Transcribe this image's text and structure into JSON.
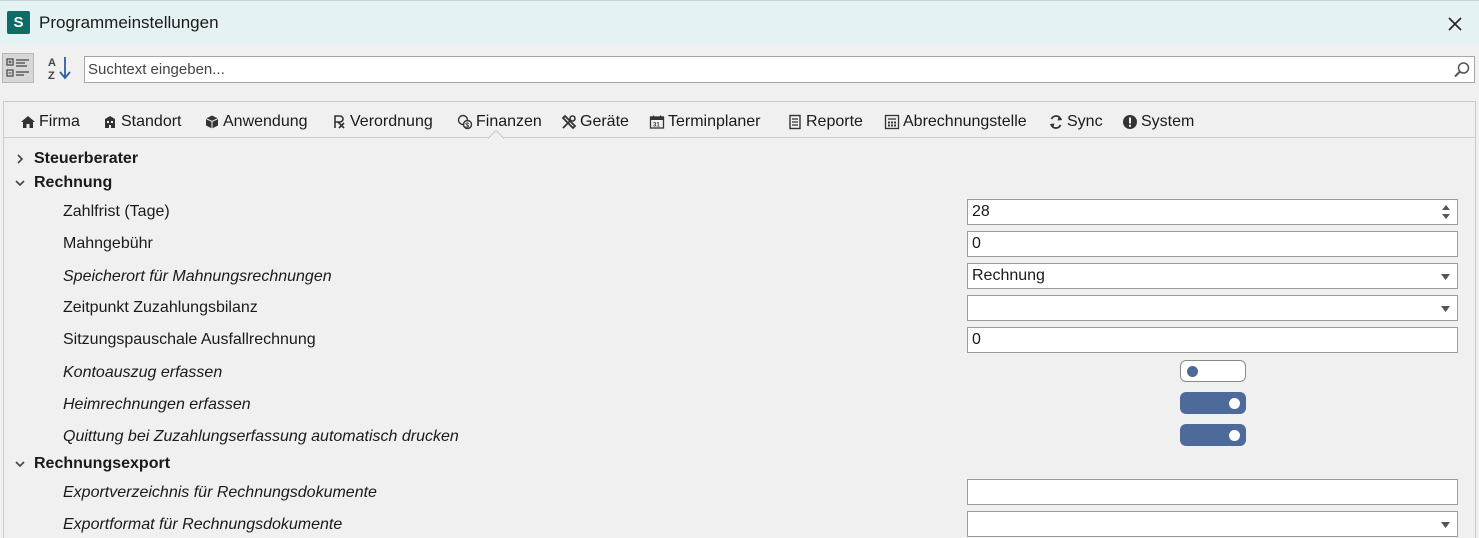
{
  "window": {
    "app_icon_letter": "S",
    "title": "Programmeinstellungen",
    "close_glyph": "✕"
  },
  "toolbar": {
    "view_categorized_icon": "categorized-view-icon",
    "sort_alpha_icon": "sort-az-icon",
    "search_placeholder": "Suchtext eingeben...",
    "search_value": ""
  },
  "tabs": [
    {
      "label": "Firma",
      "icon": "home-icon"
    },
    {
      "label": "Standort",
      "icon": "building-icon"
    },
    {
      "label": "Anwendung",
      "icon": "cube-icon"
    },
    {
      "label": "Verordnung",
      "icon": "prescription-icon"
    },
    {
      "label": "Finanzen",
      "icon": "coins-icon",
      "active": true
    },
    {
      "label": "Geräte",
      "icon": "tools-icon"
    },
    {
      "label": "Terminplaner",
      "icon": "calendar-icon"
    },
    {
      "label": "Reporte",
      "icon": "report-icon"
    },
    {
      "label": "Abrechnungstelle",
      "icon": "calculator-icon"
    },
    {
      "label": "Sync",
      "icon": "sync-icon"
    },
    {
      "label": "System",
      "icon": "alert-icon"
    }
  ],
  "groups": {
    "steuerberater": {
      "label": "Steuerberater",
      "expanded": false
    },
    "rechnung": {
      "label": "Rechnung",
      "expanded": true
    },
    "rechnungsexport": {
      "label": "Rechnungsexport",
      "expanded": true
    }
  },
  "rechnung": {
    "zahlfrist": {
      "label": "Zahlfrist (Tage)",
      "value": "28"
    },
    "mahngebuehr": {
      "label": "Mahngebühr",
      "value": "0"
    },
    "speicherort": {
      "label": "Speicherort für Mahnungsrechnungen",
      "value": "Rechnung"
    },
    "zeitpunkt": {
      "label": "Zeitpunkt Zuzahlungsbilanz",
      "value": ""
    },
    "sitzungspauschale": {
      "label": "Sitzungspauschale Ausfallrechnung",
      "value": "0"
    },
    "kontoauszug": {
      "label": "Kontoauszug erfassen",
      "on": false
    },
    "heimrechnungen": {
      "label": "Heimrechnungen erfassen",
      "on": true
    },
    "quittung": {
      "label": "Quittung bei Zuzahlungserfassung automatisch drucken",
      "on": true
    }
  },
  "rechnungsexport": {
    "exportverzeichnis": {
      "label": "Exportverzeichnis für Rechnungsdokumente",
      "value": ""
    },
    "exportformat": {
      "label": "Exportformat für Rechnungsdokumente",
      "value": ""
    }
  },
  "colors": {
    "title_bar": "#e4f2f4",
    "app_icon": "#0f6b66",
    "toggle_accent": "#4d6a9a",
    "search_icon": "#2f5fa5"
  }
}
